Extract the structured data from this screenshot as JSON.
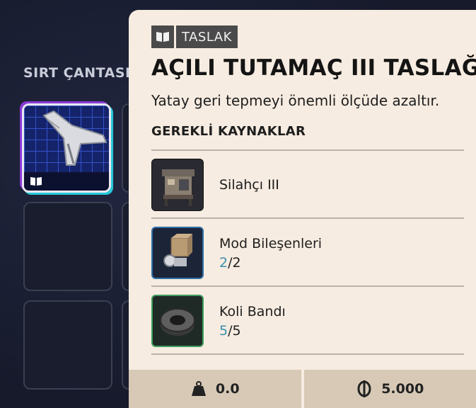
{
  "inventory": {
    "title": "SIRT ÇANTASI"
  },
  "item": {
    "tag": "TASLAK",
    "title": "AÇILI TUTAMAÇ III TASLAĞI",
    "description": "Yatay geri tepmeyi önemli ölçüde azaltır.",
    "requirements_title": "GEREKLİ KAYNAKLAR",
    "requirements": [
      {
        "name": "Silahçı III",
        "have": "",
        "sep": "",
        "need": ""
      },
      {
        "name": "Mod Bileşenleri",
        "have": "2",
        "sep": "/",
        "need": "2"
      },
      {
        "name": "Koli Bandı",
        "have": "5",
        "sep": "/",
        "need": "5"
      }
    ],
    "weight": "0.0",
    "price": "5.000"
  },
  "colors": {
    "panel_bg": "#f7ece1",
    "footer_bg": "#d7c9b6",
    "have_qty": "#3a8fb0",
    "selected_slot": "#1a2460"
  },
  "icons": [
    "blueprint-book-icon",
    "weight-icon",
    "coin-icon"
  ]
}
